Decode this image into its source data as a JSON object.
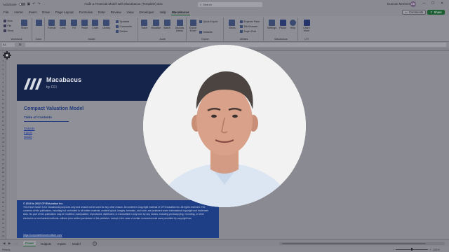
{
  "window": {
    "autosave_label": "AutoSave",
    "doc_title": "Audit a Financial Model with Macabacus (Template).xlsx",
    "search_placeholder": "Search",
    "user_name": "Duncan McKeen",
    "user_initials": "DM"
  },
  "menu": {
    "tabs": [
      "File",
      "Home",
      "Insert",
      "Draw",
      "Page Layout",
      "Formulas",
      "Data",
      "Review",
      "View",
      "Developer",
      "Help",
      "Macabacus"
    ],
    "active_tab": "Macabacus",
    "comments_label": "Comments",
    "share_label": "Share"
  },
  "ribbon": {
    "groups": [
      "Workbook",
      "Color",
      "Model",
      "Audit",
      "Export",
      "Utilities",
      "Macabacus",
      "CFI"
    ],
    "buttons": {
      "new": "New",
      "file": "File",
      "send": "Send",
      "share": "Share",
      "format": "Format",
      "cells": "Cells",
      "fill": "Fill",
      "paste": "Paste",
      "chart": "Chart",
      "library": "Library",
      "symbols": "Symbols",
      "comments": "Comments",
      "guides": "Guides",
      "trace": "Trace",
      "visualize": "Visualize",
      "watch": "Watch",
      "discuss": "Discuss (beta)",
      "export": "Export Excel",
      "quick_export": "Quick Export",
      "defaults": "Defaults",
      "views": "Views",
      "explorer": "Explorer Pane",
      "tab_browser": "Tab Browser",
      "super_find": "Super Find",
      "settings": "Settings",
      "pause": "Pause",
      "help": "Help",
      "learn": "Learn More"
    }
  },
  "formula_bar": {
    "name_box": "A1",
    "fx": "fx"
  },
  "model": {
    "brand_name": "Macabacus",
    "brand_sub": "by CFI",
    "title": "Compact Valuation Model",
    "toc_title": "Table of Contents",
    "toc_links": [
      "Outputs",
      "Inputs",
      "Model"
    ],
    "copyright": "© 2015 to 2022 CFI Education Inc.",
    "disclaimer": "This Excel model is for educational purposes only and should not be used for any other reason. All content is Copyright material of CFI Education Inc. All rights reserved. The contents of this publication, including but not limited to all written material, content layout, images, formulas, and code, are protected under international copyright and trademark laws. No part of this publication may be modified, manipulated, reproduced, distributed, or transmitted in any form by any means, including photocopying, recording, or other electronic or mechanical methods, without prior written permission of the publisher, except in the case of certain noncommercial uses permitted by copyright law.",
    "footer_link": "https://corporatefinanceinstitute.com/"
  },
  "sheets": {
    "tabs": [
      "Cover",
      "Outputs",
      "Inputs",
      "Model"
    ],
    "active": "Cover"
  },
  "status": {
    "ready": "Ready",
    "zoom": "100%"
  },
  "colors": {
    "brand_navy": "#14244a",
    "footer_blue": "#1e3f86",
    "excel_green": "#1e5e33",
    "link_blue": "#1f3a9a"
  }
}
